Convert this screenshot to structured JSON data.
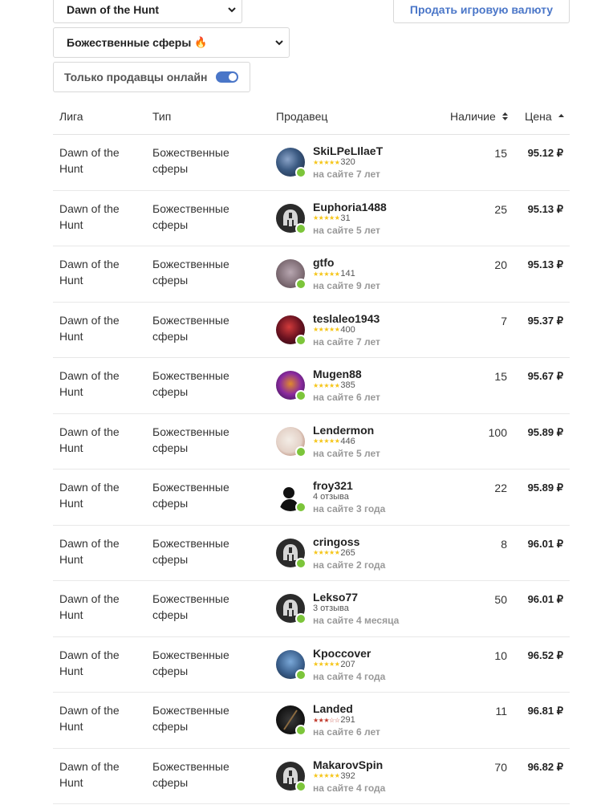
{
  "filters": {
    "league_value": "Dawn of the Hunt",
    "category_value": "Божественные сферы",
    "online_only_label": "Только продавцы онлайн",
    "online_only_on": true,
    "sell_button_label": "Продать игровую валюту"
  },
  "table": {
    "headers": {
      "league": "Лига",
      "type": "Тип",
      "seller": "Продавец",
      "availability": "Наличие",
      "price": "Цена"
    },
    "rows": [
      {
        "league": "Dawn of the Hunt",
        "type": "Божественные сферы",
        "seller": "SkiLPeLIlaeT",
        "rating_stars": 5,
        "reviews": "320",
        "since": "на сайте 7 лет",
        "qty": "15",
        "price": "95.12 ₽",
        "avatar": "wolf"
      },
      {
        "league": "Dawn of the Hunt",
        "type": "Божественные сферы",
        "seller": "Euphoria1488",
        "rating_stars": 5,
        "reviews": "31",
        "since": "на сайте 5 лет",
        "qty": "25",
        "price": "95.13 ₽",
        "avatar": "helmet"
      },
      {
        "league": "Dawn of the Hunt",
        "type": "Божественные сферы",
        "seller": "gtfo",
        "rating_stars": 5,
        "reviews": "141",
        "since": "на сайте 9 лет",
        "qty": "20",
        "price": "95.13 ₽",
        "avatar": "cat"
      },
      {
        "league": "Dawn of the Hunt",
        "type": "Божественные сферы",
        "seller": "teslaleo1943",
        "rating_stars": 5,
        "reviews": "400",
        "since": "на сайте 7 лет",
        "qty": "7",
        "price": "95.37 ₽",
        "avatar": "red"
      },
      {
        "league": "Dawn of the Hunt",
        "type": "Божественные сферы",
        "seller": "Mugen88",
        "rating_stars": 5,
        "reviews": "385",
        "since": "на сайте 6 лет",
        "qty": "15",
        "price": "95.67 ₽",
        "avatar": "purple"
      },
      {
        "league": "Dawn of the Hunt",
        "type": "Божественные сферы",
        "seller": "Lendermon",
        "rating_stars": 5,
        "reviews": "446",
        "since": "на сайте 5 лет",
        "qty": "100",
        "price": "95.89 ₽",
        "avatar": "light"
      },
      {
        "league": "Dawn of the Hunt",
        "type": "Божественные сферы",
        "seller": "froy321",
        "reviews_text": "4 отзыва",
        "since": "на сайте 3 года",
        "qty": "22",
        "price": "95.89 ₽",
        "avatar": "silhouette"
      },
      {
        "league": "Dawn of the Hunt",
        "type": "Божественные сферы",
        "seller": "cringoss",
        "rating_stars": 5,
        "reviews": "265",
        "since": "на сайте 2 года",
        "qty": "8",
        "price": "96.01 ₽",
        "avatar": "helmet"
      },
      {
        "league": "Dawn of the Hunt",
        "type": "Божественные сферы",
        "seller": "Lekso77",
        "reviews_text": "3 отзыва",
        "since": "на сайте 4 месяца",
        "qty": "50",
        "price": "96.01 ₽",
        "avatar": "helmet"
      },
      {
        "league": "Dawn of the Hunt",
        "type": "Божественные сферы",
        "seller": "Kpoccover",
        "rating_stars": 5,
        "reviews": "207",
        "since": "на сайте 4 года",
        "qty": "10",
        "price": "96.52 ₽",
        "avatar": "blue"
      },
      {
        "league": "Dawn of the Hunt",
        "type": "Божественные сферы",
        "seller": "Landed",
        "rating_stars": 3,
        "rating_color": "red",
        "reviews": "291",
        "since": "на сайте 6 лет",
        "qty": "11",
        "price": "96.81 ₽",
        "avatar": "dark"
      },
      {
        "league": "Dawn of the Hunt",
        "type": "Божественные сферы",
        "seller": "MakarovSpin",
        "rating_stars": 5,
        "reviews": "392",
        "since": "на сайте 4 года",
        "qty": "70",
        "price": "96.82 ₽",
        "avatar": "helmet"
      }
    ]
  },
  "colors": {
    "accent": "#4a76c8",
    "online": "#7cc53a",
    "star_gold": "#f5c518",
    "star_red": "#c0392b"
  }
}
